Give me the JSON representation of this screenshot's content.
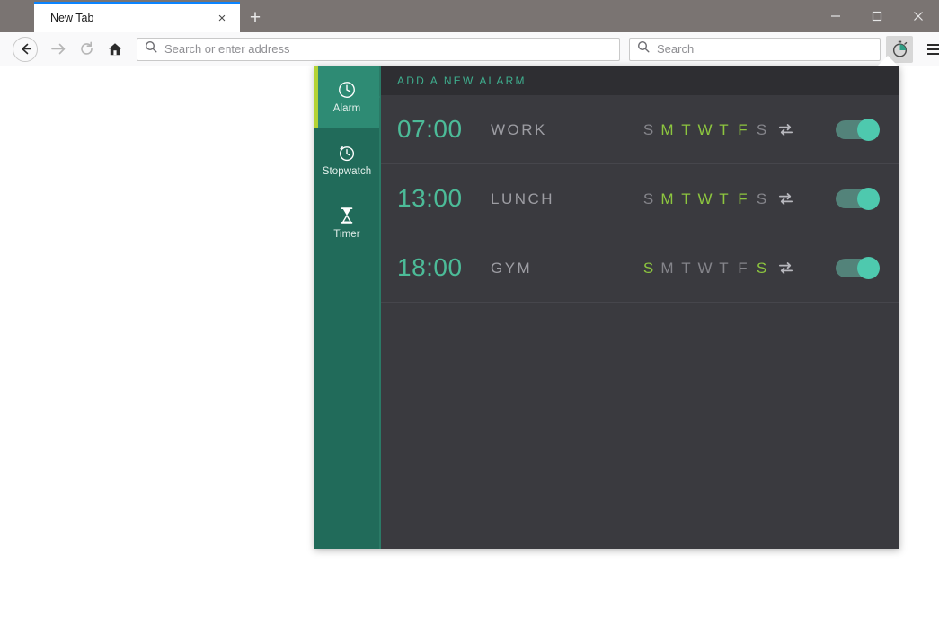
{
  "browser": {
    "tab": {
      "title": "New Tab",
      "close_label": "×"
    },
    "new_tab_label": "+",
    "window_controls": {
      "minimize": "minimize-button",
      "maximize": "maximize-button",
      "close": "close-button"
    },
    "nav": {
      "back": "back-button",
      "forward": "forward-button",
      "reload": "reload-button",
      "home": "home-button"
    },
    "address_bar": {
      "value": "",
      "placeholder": "Search or enter address"
    },
    "search_bar": {
      "value": "",
      "placeholder": "Search"
    },
    "extension_button": {
      "name": "stopwatch-extension-icon",
      "active": true
    },
    "menu_button": "open-application-menu"
  },
  "popup": {
    "sidebar": {
      "items": [
        {
          "label": "Alarm",
          "icon": "clock-icon",
          "active": true
        },
        {
          "label": "Stopwatch",
          "icon": "stopwatch-icon",
          "active": false
        },
        {
          "label": "Timer",
          "icon": "hourglass-icon",
          "active": false
        }
      ]
    },
    "header": {
      "title": "ADD A NEW ALARM"
    },
    "day_initials": [
      "S",
      "M",
      "T",
      "W",
      "T",
      "F",
      "S"
    ],
    "alarms": [
      {
        "time": "07:00",
        "label": "WORK",
        "days_active": [
          false,
          true,
          true,
          true,
          true,
          true,
          false
        ],
        "repeat": true,
        "enabled": true
      },
      {
        "time": "13:00",
        "label": "LUNCH",
        "days_active": [
          false,
          true,
          true,
          true,
          true,
          true,
          false
        ],
        "repeat": true,
        "enabled": true
      },
      {
        "time": "18:00",
        "label": "GYM",
        "days_active": [
          true,
          false,
          false,
          false,
          false,
          false,
          true
        ],
        "repeat": true,
        "enabled": true
      }
    ]
  },
  "colors": {
    "accent_teal": "#2e8b74",
    "sidebar_teal": "#216b5a",
    "lime": "#8dc63f",
    "time_teal": "#4cbb98",
    "header_teal": "#3fae8e",
    "panel_bg": "#3a3a3f",
    "header_bg": "#2e2e32",
    "toggle_knob": "#4ec9ae",
    "tab_accent": "#0a84ff"
  }
}
